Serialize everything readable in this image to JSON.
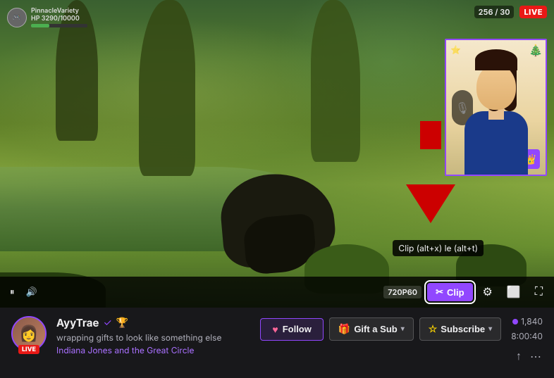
{
  "video": {
    "hud": {
      "player_name": "PinnacleVariety",
      "hp_current": "3290",
      "hp_max": "10000",
      "hp_percent": 33,
      "viewer_count": "256 / 30",
      "live_label": "LIVE"
    },
    "quality_label": "720P60",
    "tooltip_text": "Clip (alt+x) le (alt+t)",
    "clip_label": "Clip",
    "controls": {
      "play_pause": "▶",
      "mute": "🔊",
      "settings": "⚙",
      "theater": "⬜",
      "fullscreen": "⛶"
    }
  },
  "stream_info": {
    "streamer_name": "AyyTrae",
    "verified": true,
    "prime": true,
    "title": "wrapping gifts to look like something else",
    "game": "Indiana Jones and the Great Circle",
    "live_label": "LIVE",
    "follow_label": "Follow",
    "gift_label": "Gift a Sub",
    "subscribe_label": "Subscribe",
    "viewer_count": "1,840",
    "stream_time": "8:00:40",
    "viewers_icon": "👁",
    "share_icon": "↑",
    "more_icon": "⋯"
  }
}
